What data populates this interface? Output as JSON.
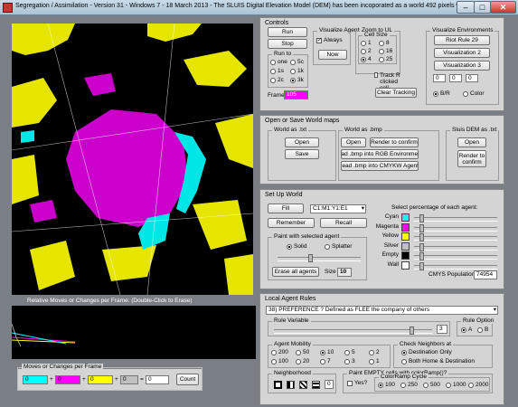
{
  "window": {
    "title": "Segregation / Assimilation - Version 31 - Windows 7 - 18 March 2013 - The SLUIS Digital Elevation Model (DEM) has been incoporated as a world 492 pixels wide and 563 high",
    "min": "–",
    "max": "□",
    "close": "✕"
  },
  "controls": {
    "title": "Controls",
    "run": "Run",
    "stop": "Stop",
    "run_to": {
      "title": "Run to",
      "options": [
        "one",
        "5c",
        "1s",
        "1k",
        "2c",
        "3k"
      ],
      "selected": "3k"
    },
    "frame_label": "Frame",
    "frame_value": "105",
    "visualize_agents": {
      "title": "Visualize Agents",
      "always": "Always",
      "now": "Now"
    },
    "zoom": {
      "title": "Zoom to UL",
      "cell_size": "Cell Size",
      "options": [
        "1",
        "2",
        "4",
        "8",
        "16",
        "25"
      ],
      "selected": "4",
      "track": "Track R clicked cell",
      "clear": "Clear Tracking"
    },
    "visualize_environments": {
      "title": "Visualize Environments",
      "b1": "Riot Rule 29",
      "b2": "Visualization 2",
      "b3": "Visualization 3",
      "values": [
        "0",
        "0",
        "0"
      ],
      "bw": "B/R",
      "color": "Color"
    }
  },
  "world_maps": {
    "title": "Open or Save World maps",
    "txt": {
      "title": "World as .txt",
      "open": "Open",
      "save": "Save"
    },
    "bmp": {
      "title": "World as .bmp",
      "open": "Open",
      "render": "Render to confirm",
      "read_rgb": "Read .bmp into RGB Environments",
      "read_cmyk": "Read .bmp into CMYKW Agents"
    },
    "dem": {
      "title": "Sluis DEM as .txt",
      "open": "Open",
      "render": "Render to confirm"
    }
  },
  "setup": {
    "title": "Set Up World",
    "fill": "Fill",
    "fill_value": "C1:M1:Y1:E1",
    "remember": "Remember",
    "recall": "Recall",
    "paint": {
      "title": "Paint with selected agent",
      "solid": "Solid",
      "splatter": "Splatter",
      "erase": "Erase all agents",
      "size_label": "Size",
      "size_value": "10"
    },
    "percentages": {
      "title": "Select percentage of each agent:",
      "agents": [
        {
          "name": "Cyan",
          "color": "#00ffff"
        },
        {
          "name": "Magenta",
          "color": "#ff00ff"
        },
        {
          "name": "Yellow",
          "color": "#ffff00"
        },
        {
          "name": "Silver",
          "color": "#c0c0c0"
        },
        {
          "name": "Empty",
          "color": "#000000"
        },
        {
          "name": "Wall",
          "color": "#ffffff"
        }
      ],
      "population_label": "CMYS Population",
      "population_value": "74954"
    }
  },
  "rules": {
    "title": "Local Agent Rules",
    "rule_select": "38) PREFERENCE ? Defined as FLEE the company of others",
    "rule_variable": {
      "title": "Rule Variable",
      "value": "3"
    },
    "rule_option": {
      "title": "Rule Option",
      "a": "A",
      "b": "B"
    },
    "mobility": {
      "title": "Agent Mobility",
      "rows": [
        [
          "200",
          "50",
          "10",
          "5",
          "2"
        ],
        [
          "100",
          "20",
          "7",
          "3",
          "1"
        ]
      ],
      "selected": "10"
    },
    "neighbors": {
      "title": "Check Neighbors at",
      "opt1": "Destination Only",
      "opt2": "Both Home & Destination"
    },
    "neighborhood": {
      "title": "Neighborhood",
      "value": "0"
    },
    "paint_empty": {
      "title": "Paint EMPTY cells with colorRamp()?",
      "yes": "Yes?",
      "ramp_title": "ColorRamp Cycle",
      "options": [
        "100",
        "250",
        "500",
        "1000",
        "2000"
      ],
      "selected": "100"
    }
  },
  "moves": {
    "graph_title": "Relative Moves or Changes per Frame:  (Double-Click to Erase)",
    "title": "Moves or Changes per Frame",
    "values": [
      "0",
      "0",
      "0",
      "0"
    ],
    "plus": "+",
    "equals": "=",
    "total": "0",
    "count": "Count"
  }
}
